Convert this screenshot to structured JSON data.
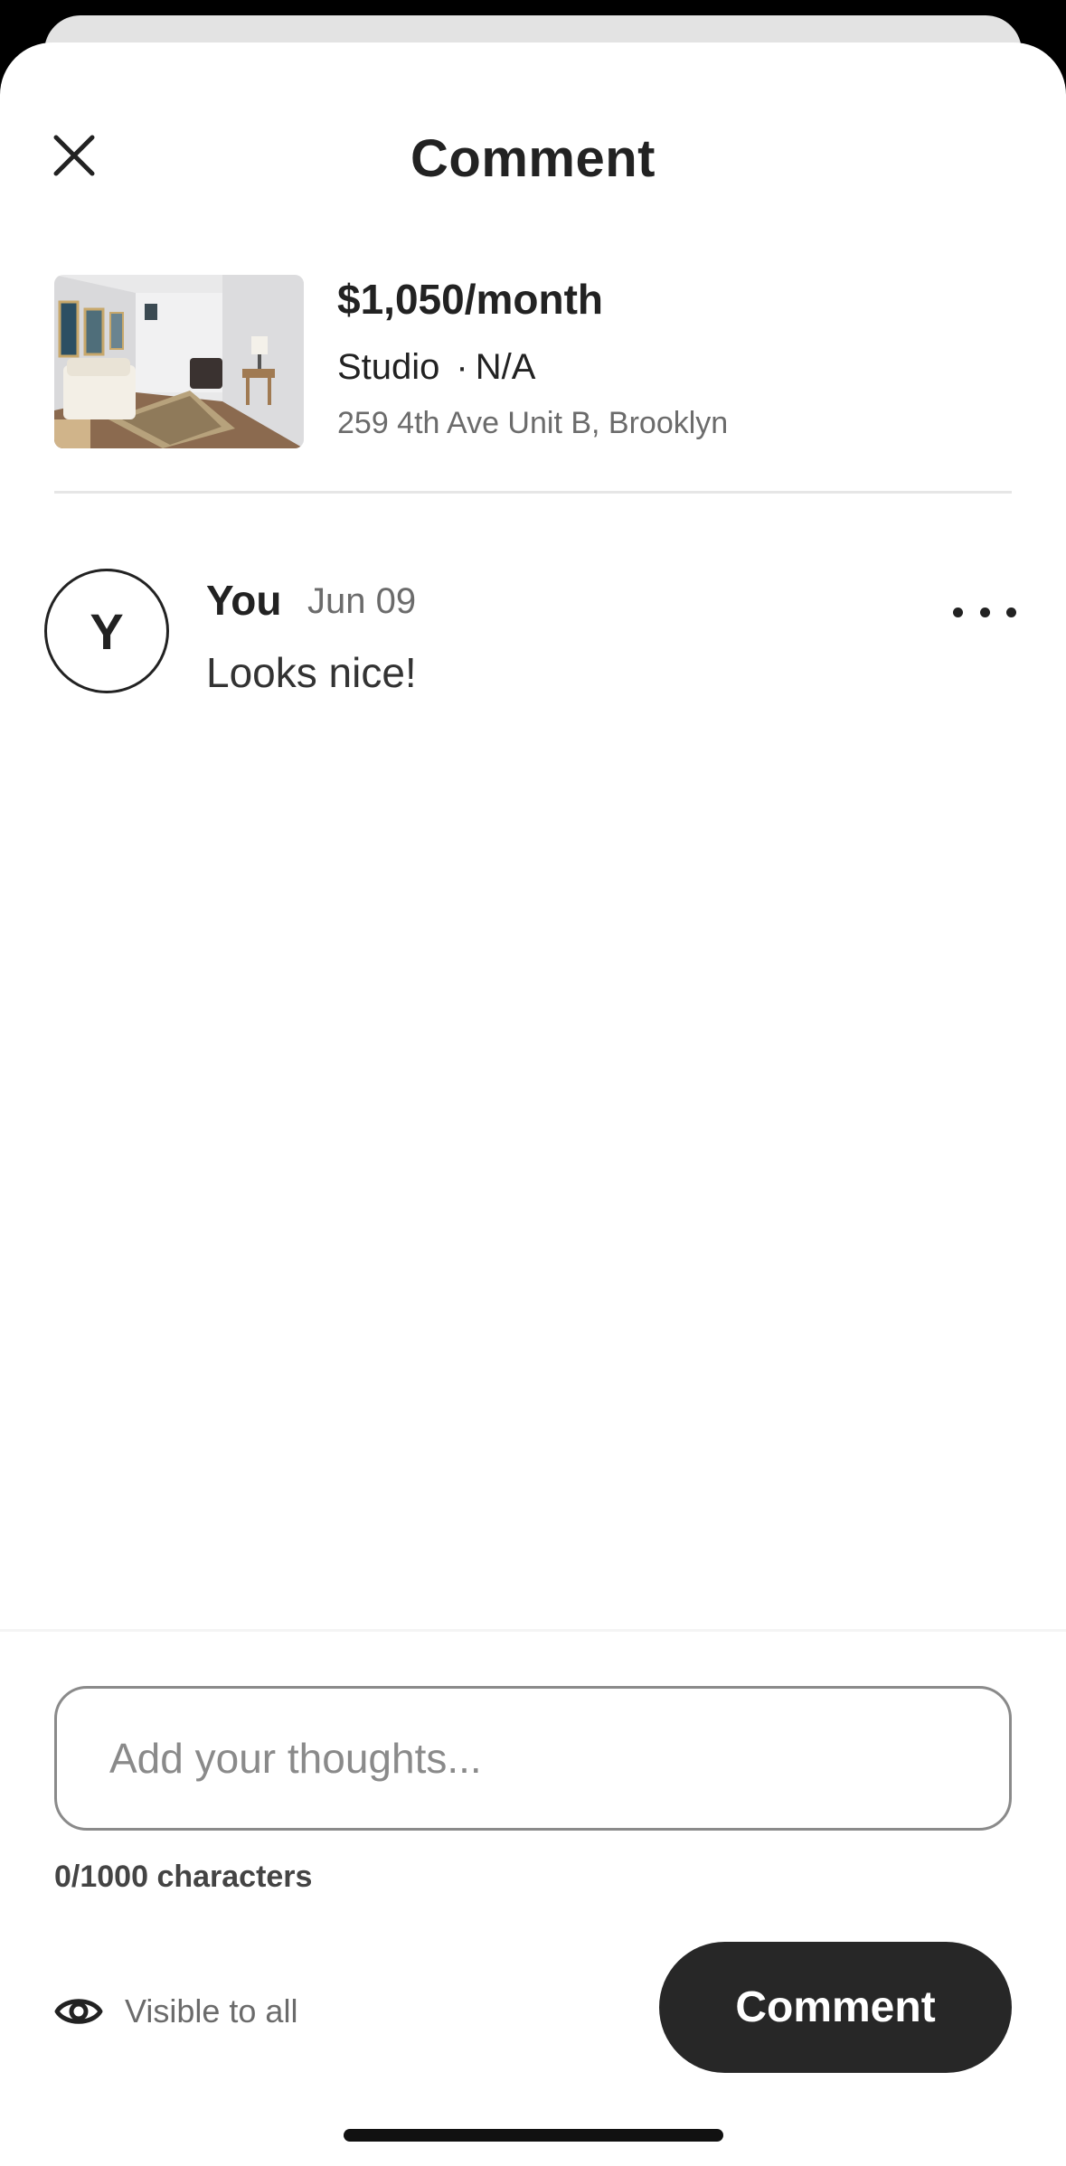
{
  "header": {
    "title": "Comment",
    "close_icon": "close-icon"
  },
  "listing": {
    "price": "$1,050/month",
    "type": "Studio",
    "separator": "·",
    "detail": "N/A",
    "address": "259 4th Ave Unit B, Brooklyn"
  },
  "comments": [
    {
      "avatar_initial": "Y",
      "author": "You",
      "date": "Jun 09",
      "text": "Looks nice!",
      "more_icon": "more-horizontal-icon"
    }
  ],
  "composer": {
    "value": "",
    "placeholder": "Add your thoughts...",
    "char_count": "0/1000 characters",
    "visibility_icon": "eye-icon",
    "visibility_label": "Visible to all",
    "submit_label": "Comment"
  },
  "colors": {
    "primary_button": "#272727",
    "text_primary": "#222222",
    "text_secondary": "#6b6b6b"
  }
}
